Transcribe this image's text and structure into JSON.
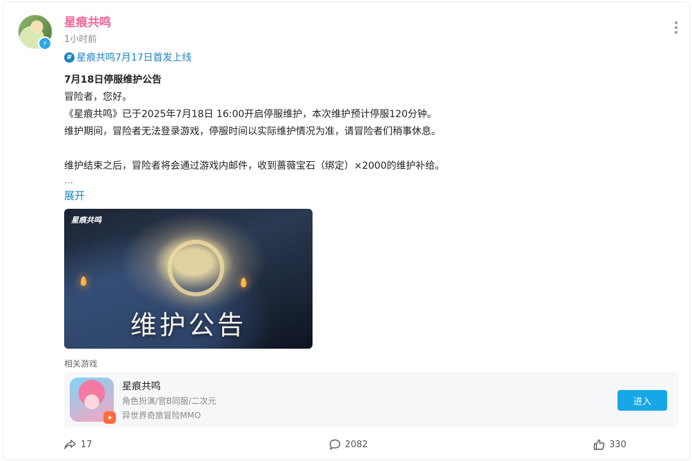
{
  "post": {
    "author": "星痕共鸣",
    "time": "1小时前",
    "topic": "星痕共鸣7月17日首发上线",
    "title": "7月18日停服维护公告",
    "lines": [
      "冒险者，您好。",
      "《星痕共鸣》已于2025年7月18日 16:00开启停服维护，本次维护预计停服120分钟。",
      "维护期间，冒险者无法登录游戏，停服时间以实际维护情况为准，请冒险者们稍事休息。",
      "维护结束之后，冒险者将会通过游戏内邮件，收到蔷薇宝石（绑定）×2000的维护补给。"
    ],
    "ellipsis": "…",
    "expand_label": "展开",
    "banner": {
      "logo": "星痕共鸣",
      "title": "维护公告"
    }
  },
  "related": {
    "label": "相关游戏",
    "game": {
      "name": "星痕共鸣",
      "tags": "角色扮演/官B同服/二次元",
      "description": "异世界奇旅冒险MMO",
      "enter_label": "进入"
    }
  },
  "actions": {
    "share_count": "17",
    "comment_count": "2082",
    "like_count": "330"
  },
  "colors": {
    "author": "#f0639a",
    "link": "#1b82c4",
    "button": "#18a7e6"
  },
  "icons": [
    "verified-icon",
    "more-icon",
    "topic-hash-icon",
    "share-icon",
    "comment-icon",
    "like-icon"
  ]
}
